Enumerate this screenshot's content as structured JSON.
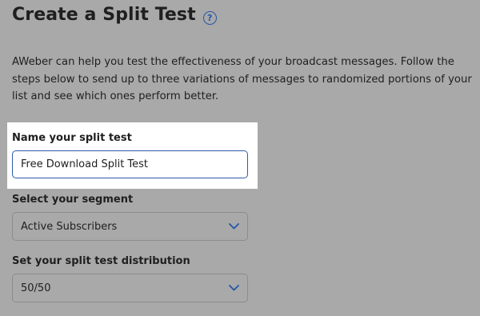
{
  "page": {
    "title": "Create a Split Test",
    "help_icon_glyph": "?",
    "intro": "AWeber can help you test the effectiveness of your broadcast messages. Follow the steps below to send up to three variations of messages to randomized portions of your list and see which ones perform better."
  },
  "form": {
    "name": {
      "label": "Name your split test",
      "value": "Free Download Split Test"
    },
    "segment": {
      "label": "Select your segment",
      "selected": "Active Subscribers"
    },
    "distribution": {
      "label": "Set your split test distribution",
      "selected": "50/50"
    }
  },
  "colors": {
    "background": "#a9a9a9",
    "accent": "#2456a6",
    "highlight": "#ffffff"
  },
  "icons": {
    "help": "help-icon",
    "chevron": "chevron-down-icon"
  }
}
